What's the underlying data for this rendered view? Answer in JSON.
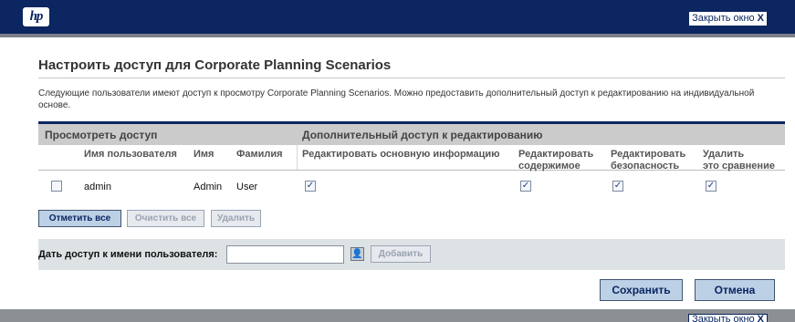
{
  "header": {
    "logo_text": "hp",
    "close_label": "Закрыть окно",
    "close_glyph": "X"
  },
  "page": {
    "title": "Настроить доступ для Corporate Planning Scenarios",
    "description": "Следующие пользователи имеют доступ к просмотру Corporate Planning Scenarios. Можно предоставить дополнительный доступ к редактированию на индивидуальной основе."
  },
  "grid": {
    "group_view": "Просмотреть доступ",
    "group_edit": "Дополнительный доступ к редактированию",
    "columns": {
      "username": "Имя пользователя",
      "first_name": "Имя",
      "last_name": "Фамилия",
      "edit_basic": "Редактировать основную информацию",
      "edit_content_1": "Редактировать",
      "edit_content_2": "содержимое",
      "edit_security_1": "Редактировать",
      "edit_security_2": "безопасность",
      "delete_1": "Удалить",
      "delete_2": "это сравнение"
    },
    "rows": [
      {
        "selected": false,
        "username": "admin",
        "first_name": "Admin",
        "last_name": "User",
        "edit_basic": true,
        "edit_content": true,
        "edit_security": true,
        "delete": true
      }
    ],
    "check_glyph": "✓"
  },
  "actions": {
    "select_all": "Отметить все",
    "clear_all": "Очистить все",
    "remove": "Удалить"
  },
  "grant": {
    "label": "Дать доступ к имени пользователя:",
    "input_value": "",
    "add_label": "Добавить",
    "picker_glyph": "👤"
  },
  "footer": {
    "save_label": "Сохранить",
    "cancel_label": "Отмена"
  }
}
